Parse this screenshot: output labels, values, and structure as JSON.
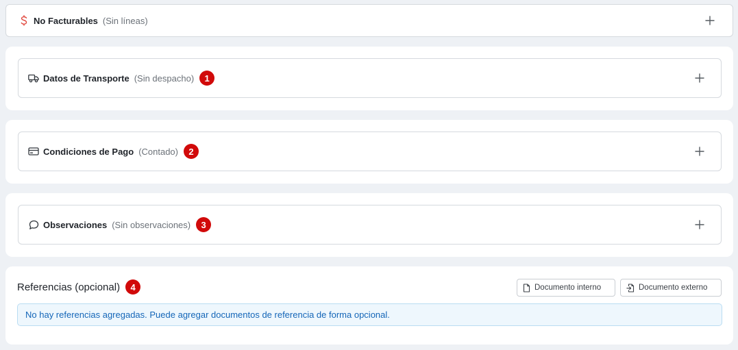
{
  "sections": {
    "no_facturables": {
      "title": "No Facturables",
      "subtitle": "(Sin líneas)"
    },
    "transporte": {
      "title": "Datos de Transporte",
      "subtitle": "(Sin despacho)",
      "badge": "1"
    },
    "pago": {
      "title": "Condiciones de Pago",
      "subtitle": "(Contado)",
      "badge": "2"
    },
    "observaciones": {
      "title": "Observaciones",
      "subtitle": "(Sin observaciones)",
      "badge": "3"
    }
  },
  "referencias": {
    "title": "Referencias (opcional)",
    "badge": "4",
    "btn_interno": "Documento interno",
    "btn_externo": "Documento externo",
    "empty_message": "No hay referencias agregadas. Puede agregar documentos de referencia de forma opcional."
  },
  "icons": {
    "no_facturables": "dollar-icon",
    "transporte": "truck-icon",
    "pago": "credit-card-icon",
    "observaciones": "chat-bubble-icon",
    "expand": "plus-icon",
    "btn_interno": "document-icon",
    "btn_externo": "document-import-icon"
  },
  "colors": {
    "badge": "#d10a0a",
    "dollar_icon": "#e0443a",
    "info_bg": "#eef7fd",
    "info_text": "#1466b8"
  }
}
